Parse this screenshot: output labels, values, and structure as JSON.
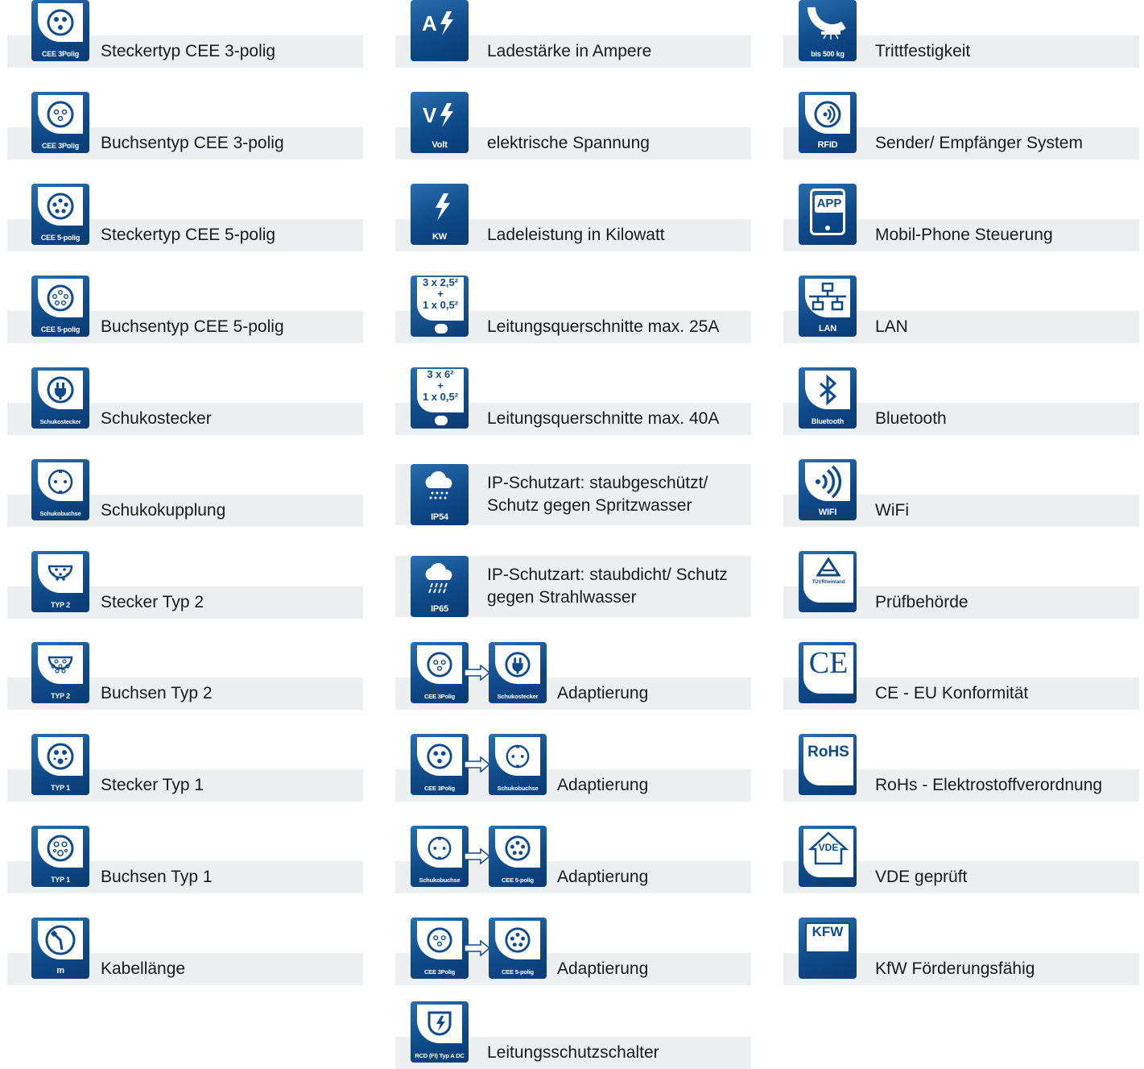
{
  "colors": {
    "icon_blue": "#0f4a8a",
    "bar_gray": "#eceef0",
    "text": "#1a1a1a"
  },
  "col1": [
    {
      "caption": "CEE 3Polig",
      "icon": "cee-3-plug-icon",
      "label": "Steckertyp CEE 3-polig"
    },
    {
      "caption": "CEE 3Polig",
      "icon": "cee-3-socket-icon",
      "label": "Buchsentyp CEE 3-polig"
    },
    {
      "caption": "CEE 5-polig",
      "icon": "cee-5-plug-icon",
      "label": "Steckertyp CEE 5-polig"
    },
    {
      "caption": "CEE 5-polig",
      "icon": "cee-5-socket-icon",
      "label": "Buchsentyp CEE 5-polig"
    },
    {
      "caption": "Schukostecker",
      "icon": "schuko-plug-icon",
      "label": "Schukostecker"
    },
    {
      "caption": "Schukobuchse",
      "icon": "schuko-socket-icon",
      "label": "Schukokupplung"
    },
    {
      "caption": "TYP 2",
      "icon": "type2-plug-icon",
      "label": "Stecker Typ 2"
    },
    {
      "caption": "TYP 2",
      "icon": "type2-socket-icon",
      "label": "Buchsen Typ 2"
    },
    {
      "caption": "TYP 1",
      "icon": "type1-plug-icon",
      "label": "Stecker Typ 1"
    },
    {
      "caption": "TYP 1",
      "icon": "type1-socket-icon",
      "label": "Buchsen Typ 1"
    },
    {
      "caption": "m",
      "icon": "cable-icon",
      "label": "Kabellänge"
    }
  ],
  "col2": [
    {
      "caption": "",
      "icon": "ampere-icon",
      "label": "Ladestärke in Ampere",
      "symbol": "A"
    },
    {
      "caption": "Volt",
      "icon": "volt-icon",
      "label": "elektrische Spannung",
      "symbol": "V"
    },
    {
      "caption": "KW",
      "icon": "lightning-icon",
      "label": "Ladeleistung in Kilowatt"
    },
    {
      "caption": "",
      "icon": "cable-cross-section-icon",
      "label": "Leitungsquerschnitte max. 25A",
      "line1": "3 x 2,5²",
      "plus": "+",
      "line2": "1 x 0,5²"
    },
    {
      "caption": "",
      "icon": "cable-cross-section-icon",
      "label": "Leitungsquerschnitte max. 40A",
      "line1": "3 x 6²",
      "plus": "+",
      "line2": "1 x 0,5²"
    },
    {
      "caption": "IP54",
      "icon": "rain-cloud-icon",
      "label": "IP-Schutzart: staubgeschützt/ Schutz gegen Spritzwasser"
    },
    {
      "caption": "IP65",
      "icon": "heavy-rain-cloud-icon",
      "label": "IP-Schutzart: staubdicht/ Schutz gegen Strahlwasser"
    },
    {
      "caption": "CEE 3Polig",
      "caption2": "Schukostecker",
      "icon": "adapter-icon",
      "label": "Adaptierung"
    },
    {
      "caption": "CEE 3Polig",
      "caption2": "Schukobuchse",
      "icon": "adapter-icon",
      "label": "Adaptierung"
    },
    {
      "caption": "Schukobuchse",
      "caption2": "CEE 5-polig",
      "icon": "adapter-icon",
      "label": "Adaptierung"
    },
    {
      "caption": "CEE 3Polig",
      "caption2": "CEE 5-polig",
      "icon": "adapter-icon",
      "label": "Adaptierung"
    },
    {
      "caption": "RCD (FI) Typ A DC",
      "icon": "shield-lightning-icon",
      "label": "Leitungsschutzschalter"
    }
  ],
  "col3": [
    {
      "caption": "bis 500 kg",
      "icon": "tread-icon",
      "label": "Trittfestigkeit"
    },
    {
      "caption": "RFID",
      "icon": "rfid-icon",
      "label": "Sender/ Empfänger System"
    },
    {
      "caption": "",
      "icon": "app-phone-icon",
      "label": "Mobil-Phone Steuerung",
      "symbol": "APP"
    },
    {
      "caption": "LAN",
      "icon": "lan-icon",
      "label": "LAN"
    },
    {
      "caption": "Bluetooth",
      "icon": "bluetooth-icon",
      "label": "Bluetooth"
    },
    {
      "caption": "WIFI",
      "icon": "wifi-icon",
      "label": "WiFi"
    },
    {
      "caption": "",
      "icon": "tuv-icon",
      "label": "Prüfbehörde",
      "logo": "TÜVRheinland"
    },
    {
      "caption": "",
      "icon": "ce-icon",
      "label": "CE - EU Konformität",
      "logo": "CE"
    },
    {
      "caption": "",
      "icon": "rohs-icon",
      "label": "RoHs - Elektrostoffverordnung",
      "logo": "RoHS"
    },
    {
      "caption": "",
      "icon": "vde-icon",
      "label": "VDE geprüft",
      "logo": "VDE"
    },
    {
      "caption": "",
      "icon": "kfw-icon",
      "label": "KfW Förderungsfähig",
      "logo": "KFW"
    }
  ]
}
